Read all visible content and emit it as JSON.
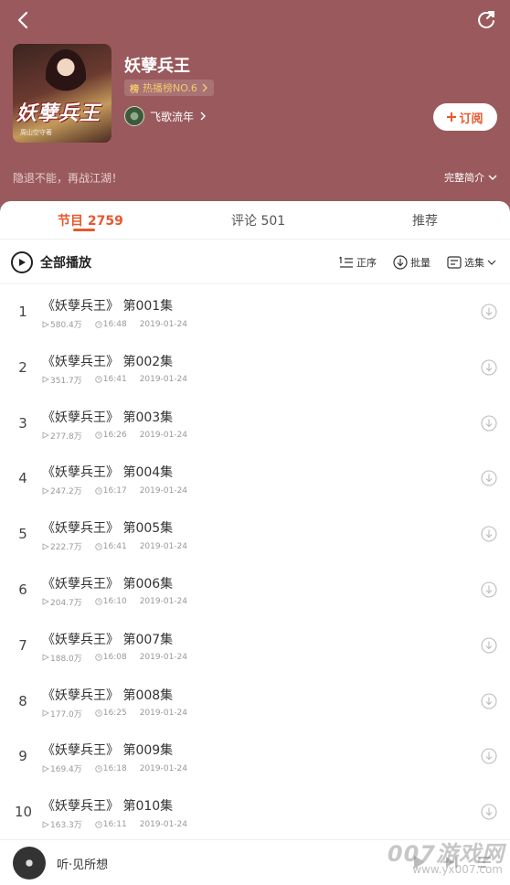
{
  "header": {
    "book_title": "妖孽兵王",
    "cover_title": "妖孽兵王",
    "cover_sub": "周山空守著",
    "rank_icon": "榜",
    "rank_text": "热播榜NO.6",
    "author": "飞歌流年",
    "subscribe_label": "订阅",
    "tagline": "隐退不能，再战江湖！",
    "full_intro": "完整简介",
    "bg_color": "#9a5a5d"
  },
  "tabs": [
    {
      "label": "节目 2759",
      "active": true
    },
    {
      "label": "评论 501",
      "active": false
    },
    {
      "label": "推荐",
      "active": false
    }
  ],
  "toolbar": {
    "play_all": "全部播放",
    "order": "正序",
    "batch": "批量",
    "select": "选集"
  },
  "episodes": [
    {
      "idx": "1",
      "title": "《妖孽兵王》 第001集",
      "plays": "580.4万",
      "duration": "16:48",
      "date": "2019-01-24"
    },
    {
      "idx": "2",
      "title": "《妖孽兵王》 第002集",
      "plays": "351.7万",
      "duration": "16:41",
      "date": "2019-01-24"
    },
    {
      "idx": "3",
      "title": "《妖孽兵王》 第003集",
      "plays": "277.8万",
      "duration": "16:26",
      "date": "2019-01-24"
    },
    {
      "idx": "4",
      "title": "《妖孽兵王》 第004集",
      "plays": "247.2万",
      "duration": "16:17",
      "date": "2019-01-24"
    },
    {
      "idx": "5",
      "title": "《妖孽兵王》 第005集",
      "plays": "222.7万",
      "duration": "16:41",
      "date": "2019-01-24"
    },
    {
      "idx": "6",
      "title": "《妖孽兵王》 第006集",
      "plays": "204.7万",
      "duration": "16:10",
      "date": "2019-01-24"
    },
    {
      "idx": "7",
      "title": "《妖孽兵王》 第007集",
      "plays": "188.0万",
      "duration": "16:08",
      "date": "2019-01-24"
    },
    {
      "idx": "8",
      "title": "《妖孽兵王》 第008集",
      "plays": "177.0万",
      "duration": "16:25",
      "date": "2019-01-24"
    },
    {
      "idx": "9",
      "title": "《妖孽兵王》 第009集",
      "plays": "169.4万",
      "duration": "16:18",
      "date": "2019-01-24"
    },
    {
      "idx": "10",
      "title": "《妖孽兵王》 第010集",
      "plays": "163.3万",
      "duration": "16:11",
      "date": "2019-01-24"
    }
  ],
  "player": {
    "title": "听·见所想"
  },
  "watermark": {
    "text": "007游戏网",
    "url": "www.yx007.com"
  },
  "colors": {
    "accent": "#e8582c",
    "header_bg": "#9a5a5d"
  }
}
